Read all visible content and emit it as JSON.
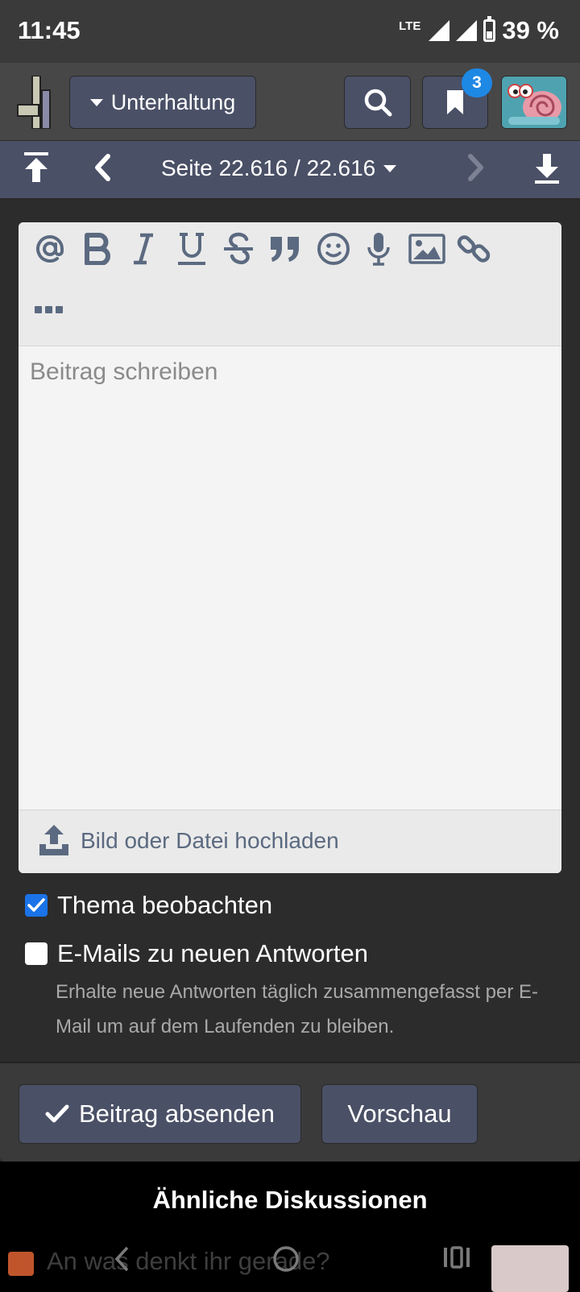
{
  "status_bar": {
    "time": "11:45",
    "network": "LTE",
    "battery_percent": "39 %",
    "battery_level": 0.39
  },
  "header": {
    "forum_selector": "Unterhaltung",
    "notification_count": "3"
  },
  "pager": {
    "label": "Seite 22.616 / 22.616"
  },
  "editor": {
    "toolbar": [
      "mention",
      "bold",
      "italic",
      "underline",
      "strikethrough",
      "quote",
      "emoji",
      "microphone",
      "image",
      "link",
      "more"
    ],
    "placeholder": "Beitrag schreiben",
    "upload_label": "Bild oder Datei hochladen"
  },
  "options": {
    "watch_label": "Thema beobachten",
    "watch_checked": true,
    "email_label": "E-Mails zu neuen Antworten",
    "email_checked": false,
    "email_hint": "Erhalte neue Antworten täglich zusammengefasst per E-Mail um auf dem Laufenden zu bleiben."
  },
  "actions": {
    "submit_label": "Beitrag absenden",
    "preview_label": "Vorschau"
  },
  "similar": {
    "title": "Ähnliche Diskussionen"
  },
  "bottom": {
    "prompt": "An was denkt ihr gerade?"
  },
  "colors": {
    "accent": "#4a5066",
    "badge": "#1e88e5",
    "checkbox": "#1a73e8",
    "icon": "#5b6a80"
  }
}
